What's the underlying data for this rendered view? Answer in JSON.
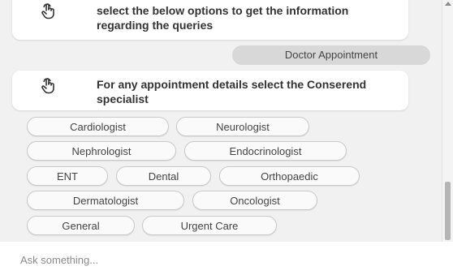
{
  "messages": {
    "bot_intro": "select the below options to get the information regarding the queries",
    "user_choice": "Doctor Appointment",
    "bot_prompt": "For any appointment details select the Conserend specialist"
  },
  "icons": {
    "bot_icon": "pointing-hand-icon"
  },
  "options": [
    "Cardiologist",
    "Neurologist",
    "Nephrologist",
    "Endocrinologist",
    "ENT",
    "Dental",
    "Orthopaedic",
    "Dermatologist",
    "Oncologist",
    "General",
    "Urgent Care"
  ],
  "input": {
    "placeholder": "Ask something..."
  }
}
